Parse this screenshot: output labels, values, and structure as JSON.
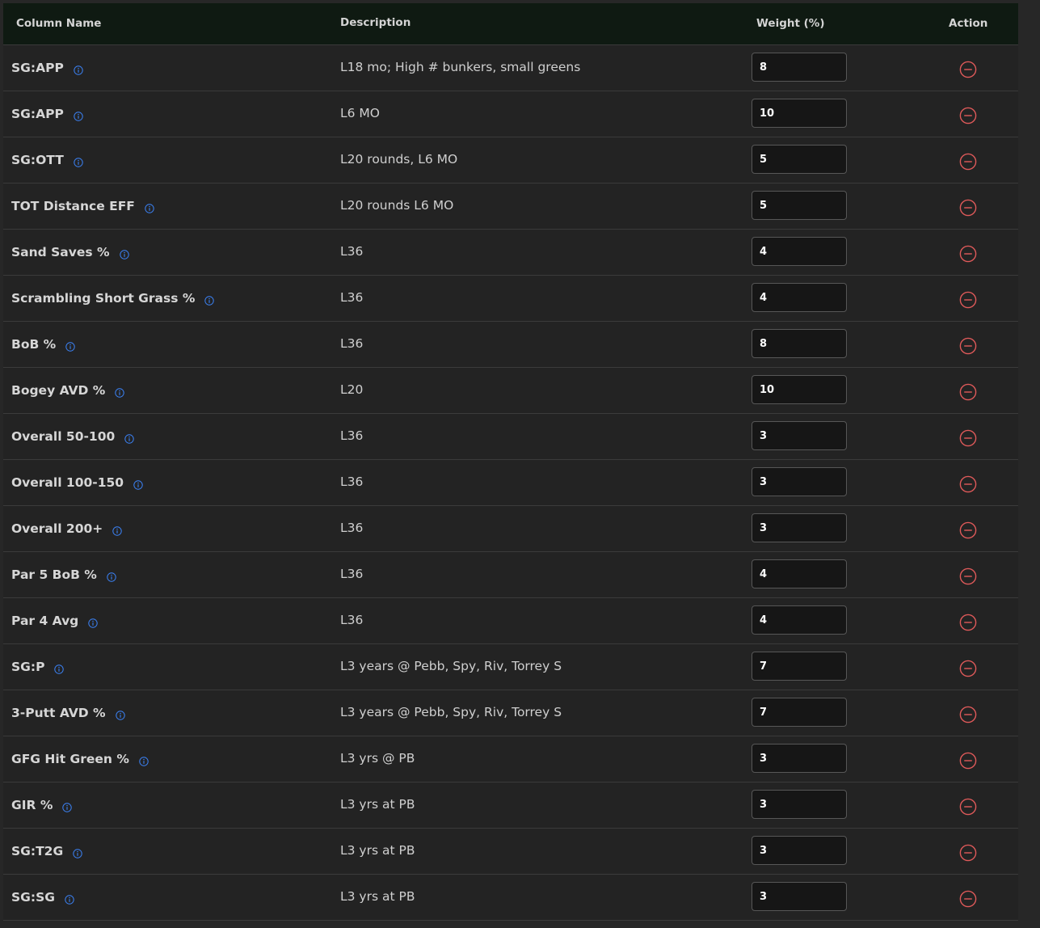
{
  "headers": {
    "column_name": "Column Name",
    "description": "Description",
    "weight": "Weight (%)",
    "action": "Action"
  },
  "colors": {
    "header_bg": "#0f1a12",
    "row_bg": "#232323",
    "info_icon": "#3b82f6",
    "remove_icon": "#e05a5a"
  },
  "icons": {
    "info": "info-icon",
    "remove": "minus-circle-icon"
  },
  "rows": [
    {
      "name": "SG:APP",
      "description": "L18 mo; High # bunkers, small greens",
      "weight": "8"
    },
    {
      "name": "SG:APP",
      "description": "L6 MO",
      "weight": "10"
    },
    {
      "name": "SG:OTT",
      "description": "L20 rounds, L6 MO",
      "weight": "5"
    },
    {
      "name": "TOT Distance EFF",
      "description": "L20 rounds L6 MO",
      "weight": "5"
    },
    {
      "name": "Sand Saves %",
      "description": "L36",
      "weight": "4"
    },
    {
      "name": "Scrambling Short Grass %",
      "description": "L36",
      "weight": "4"
    },
    {
      "name": "BoB %",
      "description": "L36",
      "weight": "8"
    },
    {
      "name": "Bogey AVD %",
      "description": "L20",
      "weight": "10"
    },
    {
      "name": "Overall 50-100",
      "description": "L36",
      "weight": "3"
    },
    {
      "name": "Overall 100-150",
      "description": "L36",
      "weight": "3"
    },
    {
      "name": "Overall 200+",
      "description": "L36",
      "weight": "3"
    },
    {
      "name": "Par 5 BoB %",
      "description": "L36",
      "weight": "4"
    },
    {
      "name": "Par 4 Avg",
      "description": "L36",
      "weight": "4"
    },
    {
      "name": "SG:P",
      "description": "L3 years @ Pebb, Spy, Riv, Torrey S",
      "weight": "7"
    },
    {
      "name": "3-Putt AVD %",
      "description": "L3 years @ Pebb, Spy, Riv, Torrey S",
      "weight": "7"
    },
    {
      "name": "GFG Hit Green %",
      "description": "L3 yrs @ PB",
      "weight": "3"
    },
    {
      "name": "GIR %",
      "description": "L3 yrs at PB",
      "weight": "3"
    },
    {
      "name": "SG:T2G",
      "description": "L3 yrs at PB",
      "weight": "3"
    },
    {
      "name": "SG:SG",
      "description": "L3 yrs at PB",
      "weight": "3"
    }
  ]
}
